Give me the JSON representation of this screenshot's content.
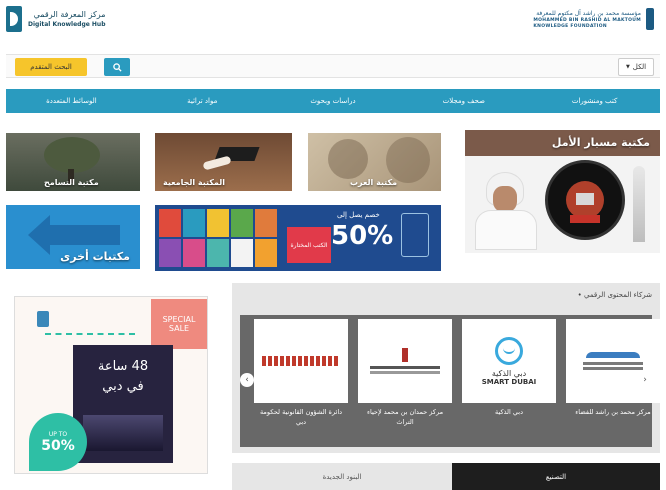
{
  "header": {
    "logo_left_ar": "مركز المعرفة الرقمي",
    "logo_left_en": "Digital Knowledge Hub",
    "logo_right_ar": "مؤسسة محمد بن راشد آل مكتوم للمعرفة",
    "logo_right_en_1": "MOHAMMED BIN RASHID AL MAKTOUM",
    "logo_right_en_2": "KNOWLEDGE FOUNDATION"
  },
  "search": {
    "scope_label": "الكل",
    "placeholder": "",
    "advanced_label": "البحث المتقدم",
    "button_icon": "search-icon"
  },
  "nav": {
    "items": [
      "كتب ومنشورات",
      "صحف ومجلات",
      "دراسات وبحوث",
      "مواد تراثية",
      "الوسائط المتعددة"
    ]
  },
  "tiles": {
    "hope_library": "مكتبة مسبار الأمل",
    "arab_library": "مكتبة العرب",
    "university_library": "المكتبة الجامعية",
    "tolerance_library": "مكتبة التسامح",
    "discount_line1": "خصم يصل إلى",
    "discount_value": "50%",
    "discount_badge": "الكتب المختارة",
    "other_libraries": "مكتبات أخرى"
  },
  "promo": {
    "sale_line1": "SPECIAL",
    "sale_line2": "SALE",
    "book_line1": "48 ساعة",
    "book_line2": "في دبي",
    "up_to": "UP TO",
    "percent": "50%"
  },
  "partners": {
    "heading": "شركاء المحتوى الرقمي",
    "items": [
      {
        "name": "مركز محمد بن راشد للفضاء"
      },
      {
        "name": "دبي الذكية"
      },
      {
        "name": "مركز حمدان بن محمد لإحياء التراث"
      },
      {
        "name": "دائرة الشؤون القانونية لحكومة دبي"
      }
    ],
    "smart_dubai_ar": "دبي الذكية",
    "smart_dubai_en": "SMART DUBAI"
  },
  "tabs": {
    "left": "البنود الجديدة",
    "right": "التصنيع"
  },
  "colors": {
    "accent": "#2a9bbf",
    "cta": "#f6c52b",
    "panel": "#686868"
  }
}
